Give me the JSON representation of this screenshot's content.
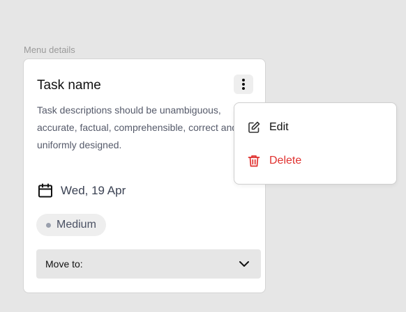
{
  "section_label": "Menu details",
  "card": {
    "title": "Task name",
    "description": "Task descriptions should be unambiguous, accurate, factual, comprehensible, correct and uniformly designed.",
    "date": "Wed, 19 Apr",
    "priority": "Medium",
    "move_to_label": "Move to:"
  },
  "menu": {
    "items": [
      {
        "label": "Edit",
        "icon": "edit-icon",
        "color": "#111111"
      },
      {
        "label": "Delete",
        "icon": "trash-icon",
        "color": "#e0312f"
      }
    ]
  },
  "colors": {
    "background": "#e6e6e6",
    "card": "#ffffff",
    "danger": "#e0312f",
    "muted_text": "#555a6a"
  },
  "icons": {
    "more": "more-vertical-icon",
    "calendar": "calendar-icon",
    "dropdown": "chevron-down-icon"
  }
}
